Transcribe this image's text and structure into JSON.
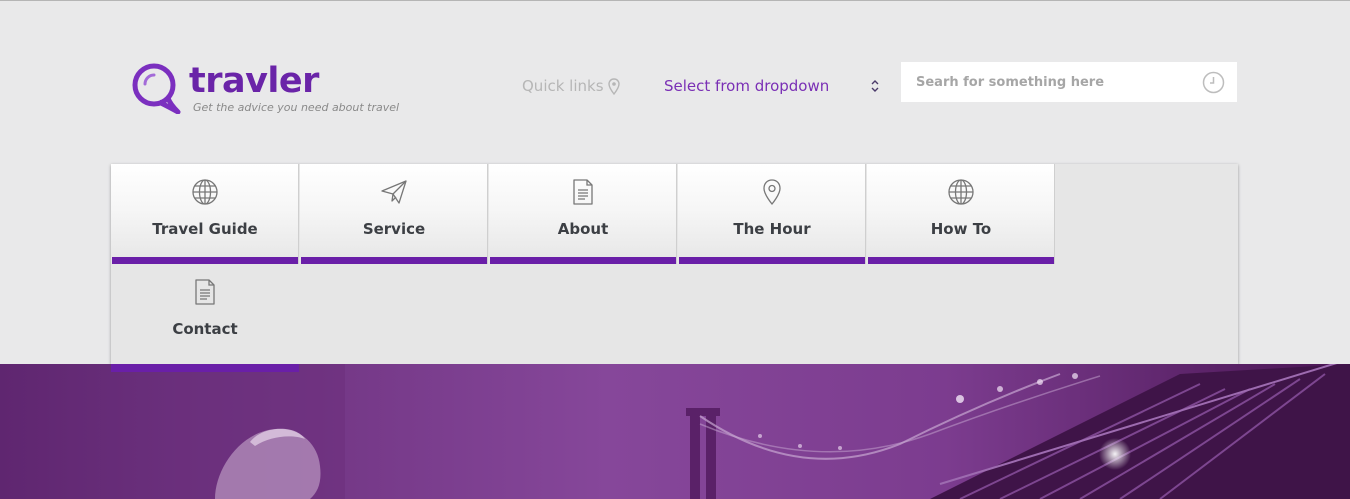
{
  "brand": {
    "name": "travler",
    "tagline": "Get the advice you need about travel",
    "color": "#6a24a8"
  },
  "header": {
    "quick_links_label": "Quick links",
    "quick_links_icon": "map-pin-icon",
    "select_value": "Select from dropdown",
    "select_icon": "updown-chevron-icon",
    "search_placeholder": "Searh for something here",
    "search_icon": "clock-icon"
  },
  "nav": {
    "accent": "#6a1fa8",
    "items": [
      {
        "label": "Travel Guide",
        "icon": "globe-icon"
      },
      {
        "label": "Service",
        "icon": "paper-plane-icon"
      },
      {
        "label": "About",
        "icon": "document-icon"
      },
      {
        "label": "The Hour",
        "icon": "map-pin-icon"
      },
      {
        "label": "How To",
        "icon": "globe-icon"
      },
      {
        "label": "Contact",
        "icon": "document-icon"
      }
    ]
  },
  "hero": {
    "description_icon": "hero-photo"
  }
}
